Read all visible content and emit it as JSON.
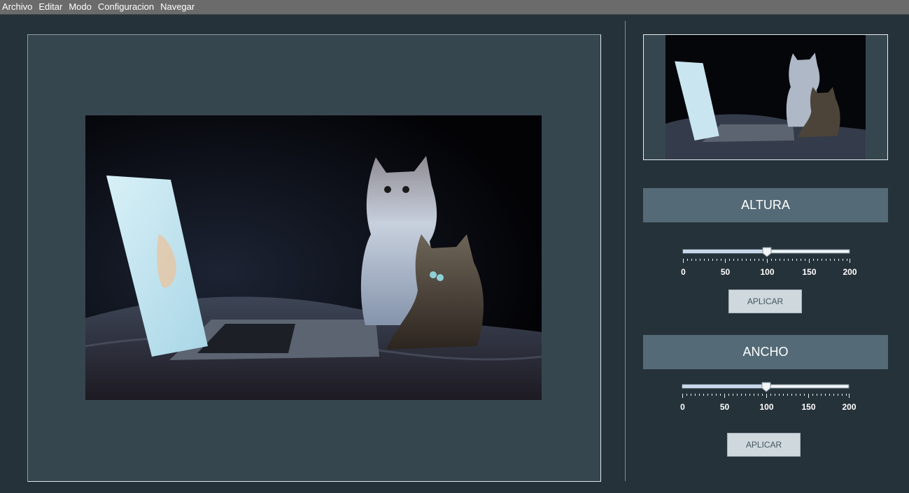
{
  "menu": {
    "items": [
      "Archivo",
      "Editar",
      "Modo",
      "Configuracion",
      "Navegar"
    ]
  },
  "image": {
    "description_icon": "photo-cats-laptop"
  },
  "altura": {
    "title": "ALTURA",
    "slider_value": 100,
    "slider_min": 0,
    "slider_max": 200,
    "ticks": [
      "0",
      "50",
      "100",
      "150",
      "200"
    ],
    "apply_label": "APLICAR"
  },
  "ancho": {
    "title": "ANCHO",
    "slider_value": 100,
    "slider_min": 0,
    "slider_max": 200,
    "ticks": [
      "0",
      "50",
      "100",
      "150",
      "200"
    ],
    "apply_label": "APLICAR"
  },
  "colors": {
    "background": "#263239",
    "panel": "#36464f",
    "header": "#546b77",
    "button": "#cfd8dc"
  }
}
